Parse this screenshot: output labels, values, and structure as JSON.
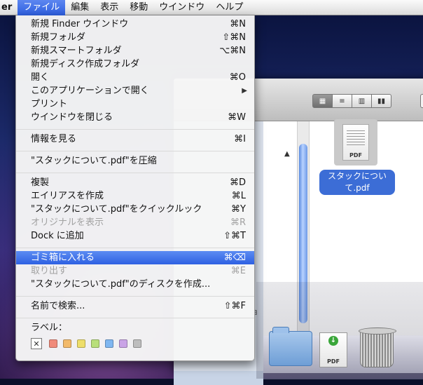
{
  "menubar": {
    "app": "er",
    "items": [
      "ファイル",
      "編集",
      "表示",
      "移動",
      "ウインドウ",
      "ヘルプ"
    ]
  },
  "file_menu": {
    "items": [
      {
        "label": "新規 Finder ウインドウ",
        "shortcut": "⌘N"
      },
      {
        "label": "新規フォルダ",
        "shortcut": "⇧⌘N"
      },
      {
        "label": "新規スマートフォルダ",
        "shortcut": "⌥⌘N"
      },
      {
        "label": "新規ディスク作成フォルダ",
        "shortcut": ""
      },
      {
        "label": "開く",
        "shortcut": "⌘O"
      },
      {
        "label": "このアプリケーションで開く",
        "shortcut": ""
      },
      {
        "label": "プリント",
        "shortcut": ""
      },
      {
        "label": "ウインドウを閉じる",
        "shortcut": "⌘W"
      },
      {
        "label": "情報を見る",
        "shortcut": "⌘I"
      },
      {
        "label": "\"スタックについて.pdf\"を圧縮",
        "shortcut": ""
      },
      {
        "label": "複製",
        "shortcut": "⌘D"
      },
      {
        "label": "エイリアスを作成",
        "shortcut": "⌘L"
      },
      {
        "label": "\"スタックについて.pdf\"をクイックルック",
        "shortcut": "⌘Y"
      },
      {
        "label": "オリジナルを表示",
        "shortcut": "⌘R"
      },
      {
        "label": "Dock に追加",
        "shortcut": "⇧⌘T"
      },
      {
        "label": "ゴミ箱に入れる",
        "shortcut": "⌘⌫"
      },
      {
        "label": "取り出す",
        "shortcut": "⌘E"
      },
      {
        "label": "\"スタックについて.pdf\"のディスクを作成...",
        "shortcut": ""
      },
      {
        "label": "名前で検索...",
        "shortcut": "⇧⌘F"
      },
      {
        "label": "ラベル：",
        "shortcut": ""
      }
    ]
  },
  "label_colors": [
    "#f08a7a",
    "#f2b96a",
    "#eede6a",
    "#b8df7a",
    "#7fb6f0",
    "#c9a3e6",
    "#bdbdbd"
  ],
  "finder": {
    "file_name": "スタックについて.pdf",
    "file_badge": "PDF",
    "sidebar_fragment": "ョ"
  },
  "dock": {
    "pdf_badge": "PDF"
  }
}
